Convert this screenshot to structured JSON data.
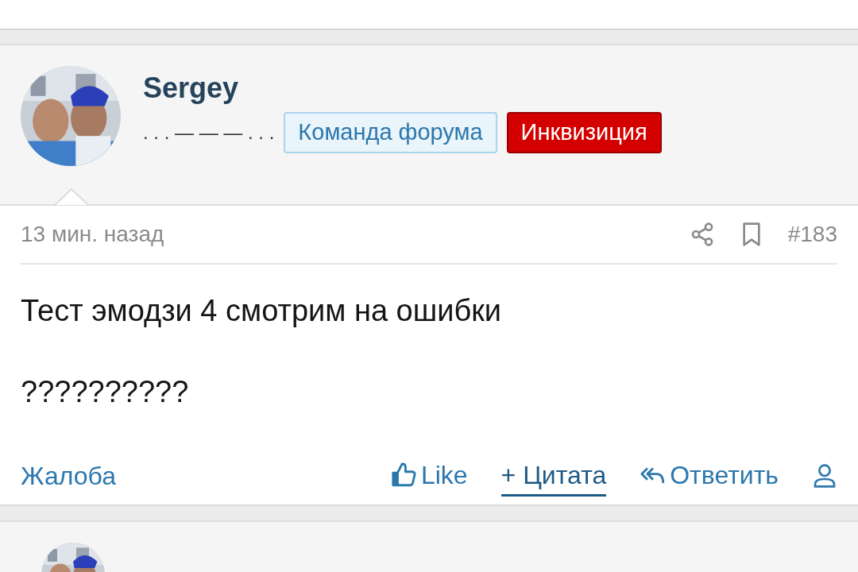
{
  "post": {
    "author": {
      "name": "Sergey",
      "user_title": ". . . — — — . . .",
      "badges": [
        {
          "label": "Команда форума",
          "kind": "staff"
        },
        {
          "label": "Инквизиция",
          "kind": "group"
        }
      ]
    },
    "time": "13 мин. назад",
    "number": "#183",
    "body": [
      "Тест эмодзи 4 смотрим на ошибки",
      "??????????"
    ],
    "report": "Жалоба",
    "actions": [
      {
        "kind": "like",
        "label": "Like",
        "active": false
      },
      {
        "kind": "quote",
        "label": "+ Цитата",
        "active": true
      },
      {
        "kind": "reply",
        "label": "Ответить",
        "active": false
      }
    ]
  }
}
